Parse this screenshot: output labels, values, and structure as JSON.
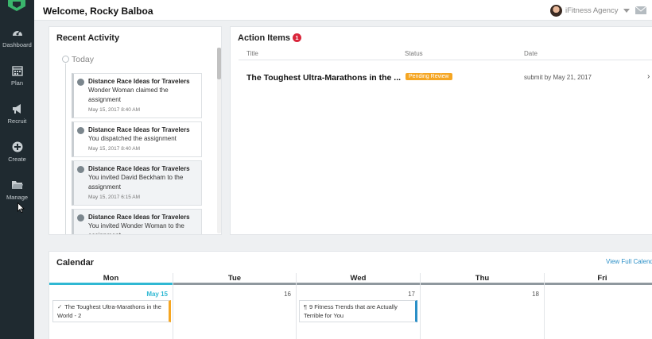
{
  "header": {
    "welcome": "Welcome, Rocky Balboa",
    "agency": "iFitness Agency",
    "menu_dots": "⋮"
  },
  "sidebar": {
    "items": [
      {
        "label": "Dashboard",
        "icon": "dashboard-icon"
      },
      {
        "label": "Plan",
        "icon": "calendar-icon"
      },
      {
        "label": "Recruit",
        "icon": "megaphone-icon"
      },
      {
        "label": "Create",
        "icon": "plus-circle-icon"
      },
      {
        "label": "Manage",
        "icon": "folder-icon"
      }
    ]
  },
  "recent_activity": {
    "title": "Recent Activity",
    "today": "Today",
    "items": [
      {
        "title": "Distance Race Ideas for Travelers",
        "desc": "Wonder Woman claimed the assignment",
        "time": "May 15, 2017 8:40 AM",
        "icon": "arrow-circle-icon"
      },
      {
        "title": "Distance Race Ideas for Travelers",
        "desc": "You dispatched the assignment",
        "time": "May 15, 2017 8:40 AM",
        "icon": "arrow-circle-icon"
      },
      {
        "title": "Distance Race Ideas for Travelers",
        "desc": "You invited David Beckham to the assignment",
        "time": "May 15, 2017 6:15 AM",
        "icon": "user-icon"
      },
      {
        "title": "Distance Race Ideas for Travelers",
        "desc": "You invited Wonder Woman to the assignment",
        "time": "",
        "icon": "user-icon"
      }
    ]
  },
  "action_items": {
    "title": "Action Items",
    "count": "1",
    "columns": {
      "title": "Title",
      "status": "Status",
      "date": "Date"
    },
    "rows": [
      {
        "title": "The Toughest Ultra-Marathons in the ...",
        "status": "Pending Review",
        "date": "submit by May 21, 2017",
        "chevron": "›"
      }
    ],
    "status_color": "#f5a623"
  },
  "calendar": {
    "title": "Calendar",
    "view_full": "View Full Calendar",
    "days": [
      {
        "name": "Mon",
        "num": "May 15"
      },
      {
        "name": "Tue",
        "num": "16"
      },
      {
        "name": "Wed",
        "num": "17"
      },
      {
        "name": "Thu",
        "num": "18"
      },
      {
        "name": "Fri",
        "num": ""
      }
    ],
    "events": [
      {
        "text": "The Toughest Ultra-Marathons in the World - 2",
        "color": "#f5a623"
      },
      {
        "text": "9 Fitness Trends that are Actually Terrible for You",
        "color": "#2a8fc7"
      }
    ],
    "today_color": "#2fb8d3"
  }
}
